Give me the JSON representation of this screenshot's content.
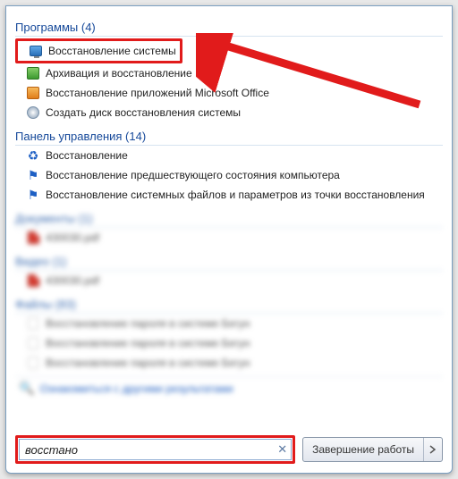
{
  "sections": {
    "programs": {
      "label": "Программы",
      "count": 4
    },
    "control_panel": {
      "label": "Панель управления",
      "count": 14
    },
    "documents": {
      "label": "Документы",
      "count": 1
    },
    "video": {
      "label": "Видео",
      "count": 1
    },
    "files": {
      "label": "Файлы",
      "count": 83
    }
  },
  "programs_items": [
    {
      "label": "Восстановление системы"
    },
    {
      "label": "Архивация и восстановление"
    },
    {
      "label": "Восстановление приложений Microsoft Office"
    },
    {
      "label": "Создать диск восстановления системы"
    }
  ],
  "control_panel_items": [
    {
      "label": "Восстановление"
    },
    {
      "label": "Восстановление предшествующего состояния компьютера"
    },
    {
      "label": "Восстановление системных файлов и параметров из точки восстановления"
    }
  ],
  "documents_items": [
    {
      "label": "430030.pdf"
    }
  ],
  "video_items": [
    {
      "label": "430030.pdf"
    }
  ],
  "files_items": [
    {
      "label": "Восстановление пароля в системе Бегун"
    },
    {
      "label": "Восстановление пароля в системе Бегун"
    },
    {
      "label": "Восстановление пароля в системе Бегун"
    }
  ],
  "see_more": "Ознакомиться с другими результатами",
  "search": {
    "value": "восстано",
    "placeholder": ""
  },
  "shutdown": {
    "label": "Завершение работы"
  }
}
